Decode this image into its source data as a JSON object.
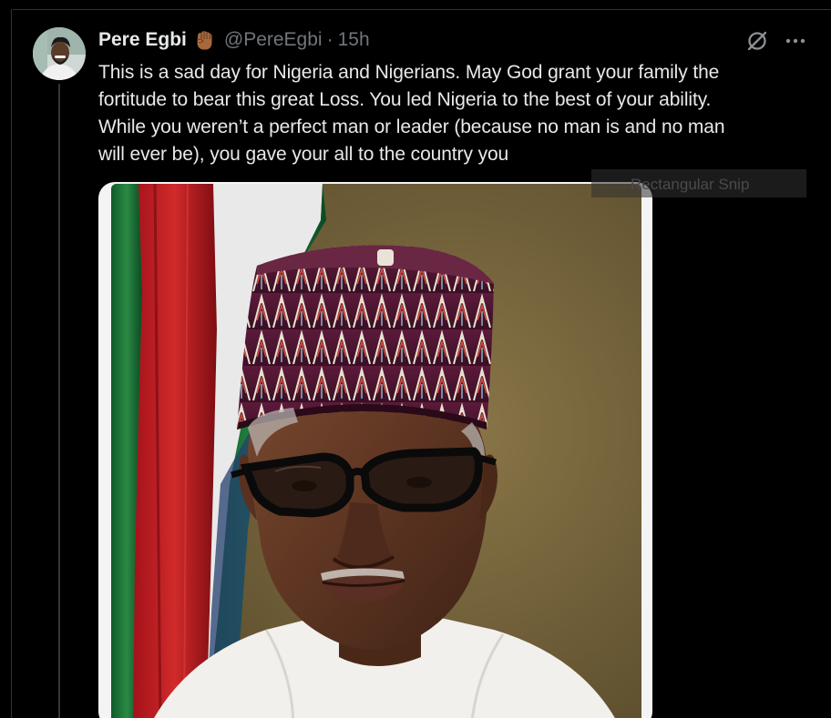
{
  "post": {
    "author": {
      "display_name": "Pere Egbi",
      "badge_emoji": "raised-fist-emoji",
      "handle": "@PereEgbi",
      "separator": "·",
      "time": "15h"
    },
    "text_lines": [
      "This is a sad day for Nigeria and Nigerians. May God grant your family the",
      "fortitude to bear this great Loss.  You led Nigeria to the best of your ability.",
      "While you weren’t a perfect man or leader (because no man is and no man",
      "will ever be), you gave your all to the country you"
    ],
    "actions": {
      "grok_icon": "grok-icon",
      "more_icon": "more-icon"
    },
    "media": {
      "type": "photo"
    }
  },
  "overlay": {
    "snip_label": "Rectangular Snip"
  },
  "colors": {
    "background": "#000000",
    "text_primary": "#e7e9ea",
    "text_secondary": "#71767b",
    "divider": "#2f3336"
  }
}
